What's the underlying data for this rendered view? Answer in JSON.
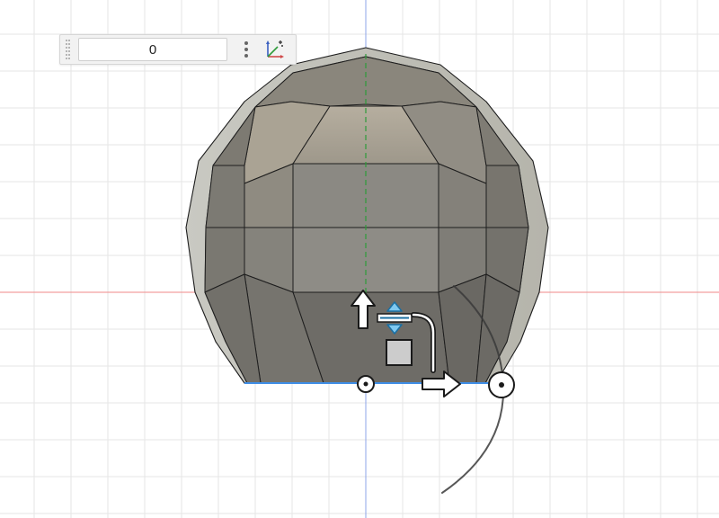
{
  "toolbar": {
    "value": "0",
    "drag_handle_icon": "grip-vertical-icon",
    "more_icon": "vertical-ellipsis-icon",
    "axis_icon": "coordinate-axes-icon"
  },
  "viewport": {
    "background": "#ffffff",
    "grid_color": "#e6e6e6",
    "x_axis_color": "#f08a8a",
    "y_axis_color": "#8ea4e8",
    "z_axis_color": "#2e9b3a",
    "mesh_color": "#8c8a80",
    "mesh_highlight": "#b1aa9b",
    "mesh_edge": "#1e1e1e",
    "selection_edge_color": "#3f8ee6"
  },
  "manipulator": {
    "icons": [
      "move-up-arrow-icon",
      "move-right-arrow-icon",
      "scale-handle-icon",
      "plane-move-icon",
      "rotate-arc-icon",
      "pivot-point-icon",
      "rotate-handle-icon",
      "corner-bracket-icon"
    ]
  }
}
